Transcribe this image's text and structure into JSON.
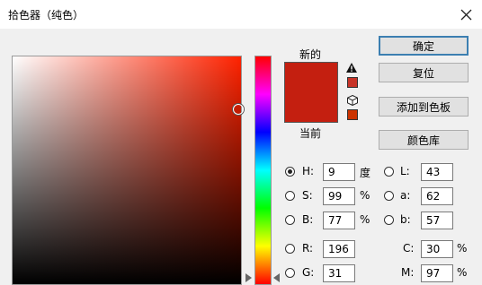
{
  "title": "拾色器（纯色）",
  "swatch": {
    "new_label": "新的",
    "current_label": "当前",
    "new_color": "#c41f10",
    "current_color": "#c41f10",
    "gamut_swatch_color": "#c83428",
    "web_swatch_color": "#cc3300"
  },
  "field": {
    "base_hue_color": "#ff2200"
  },
  "buttons": {
    "ok": "确定",
    "reset": "复位",
    "add_to_swatches": "添加到色板",
    "color_libraries": "颜色库"
  },
  "hsb": {
    "h_label": "H:",
    "h_value": "9",
    "h_unit": "度",
    "s_label": "S:",
    "s_value": "99",
    "s_unit": "%",
    "b_label": "B:",
    "b_value": "77",
    "b_unit": "%"
  },
  "lab": {
    "l_label": "L:",
    "l_value": "43",
    "a_label": "a:",
    "a_value": "62",
    "b_label": "b:",
    "b_value": "57"
  },
  "rgb": {
    "r_label": "R:",
    "r_value": "196",
    "g_label": "G:",
    "g_value": "31"
  },
  "cmyk": {
    "c_label": "C:",
    "c_value": "30",
    "c_unit": "%",
    "m_label": "M:",
    "m_value": "97",
    "m_unit": "%"
  },
  "icons": {
    "close": "close-icon",
    "gamut_warning": "warning-triangle-icon",
    "web_safe": "cube-icon"
  }
}
